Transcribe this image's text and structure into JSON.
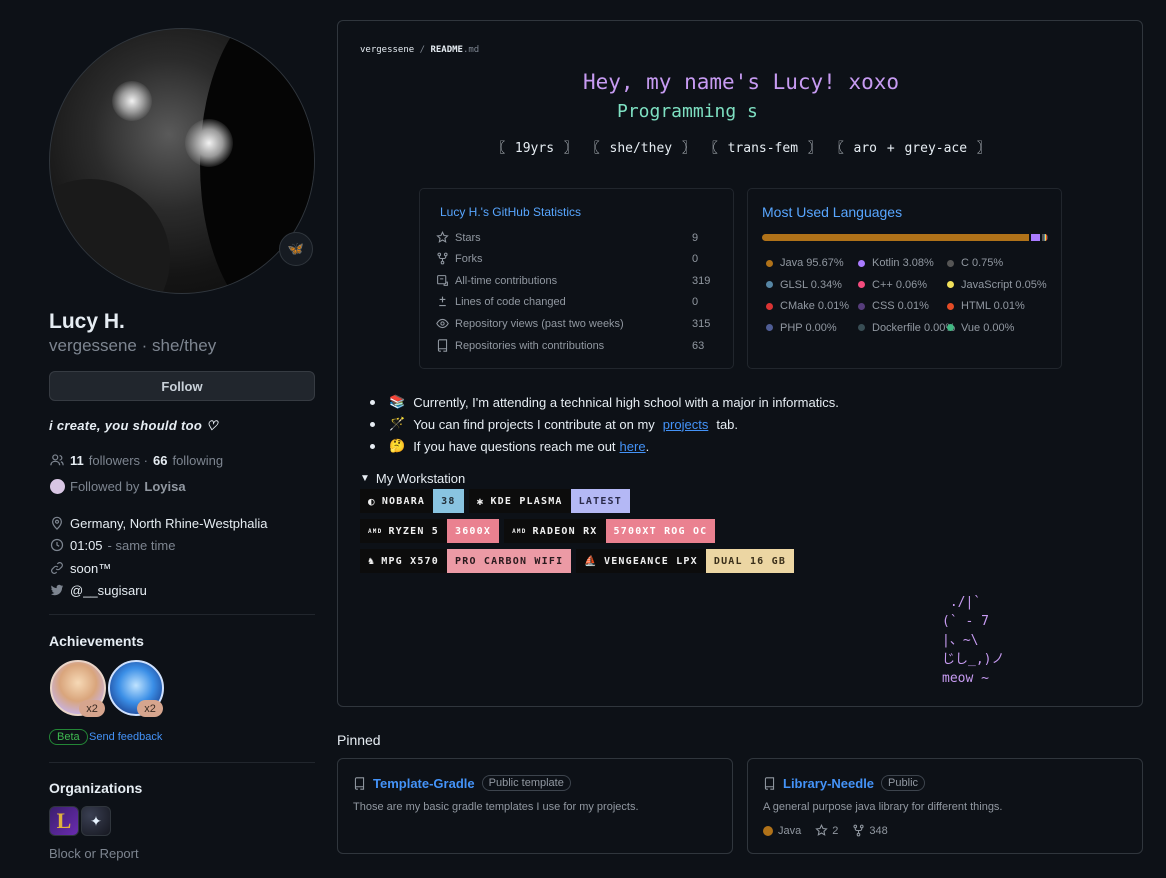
{
  "profile": {
    "name": "Lucy H.",
    "login_line": "vergessene · she/they",
    "follow_label": "Follow",
    "bio": "i create, you should too ♡",
    "followers_count": "11",
    "followers_label": "followers ·",
    "following_count": "66",
    "following_label": "following",
    "followed_by_prefix": "Followed by",
    "followed_by_name": "Loyisa",
    "location": "Germany, North Rhine-Westphalia",
    "time": "01:05",
    "time_note": "- same time",
    "website": "soon™",
    "twitter": "@__sugisaru",
    "status_emoji": "🦋"
  },
  "achievements": {
    "heading": "Achievements",
    "items": [
      {
        "count": "x2"
      },
      {
        "count": "x2"
      }
    ],
    "beta_label": "Beta",
    "feedback_label": "Send feedback"
  },
  "organizations": {
    "heading": "Organizations",
    "block_label": "Block or Report"
  },
  "readme": {
    "crumb_user": "vergessene",
    "crumb_sep": "/",
    "crumb_file": "README",
    "crumb_ext": ".md",
    "greeting": "Hey, my name's Lucy! xoxo",
    "typing": "Programming s",
    "tags": "〖 19yrs 〗 〖 she/they 〗 〖 trans-fem 〗 〖 aro + grey-ace 〗",
    "bullets": [
      {
        "emoji": "📚",
        "text": "Currently, I'm attending a technical high school with a major in informatics."
      },
      {
        "emoji": "🪄",
        "pre": "You can find projects I contribute at on my",
        "link": "projects",
        "post": "tab."
      },
      {
        "emoji": "🤔",
        "pre": "If you have questions reach me out",
        "link": "here",
        "post": "."
      }
    ],
    "workstation_label": "My Workstation",
    "badges": {
      "nobara": "NOBARA",
      "nobara_ver": "38",
      "kde": "KDE PLASMA",
      "kde_ver": "LATEST",
      "ryzen": "RYZEN 5",
      "ryzen_ver": "3600X",
      "radeon": "RADEON RX",
      "radeon_ver": "5700XT ROG OC",
      "mpg": "MPG X570",
      "mpg_ver": "PRO CARBON WIFI",
      "vengeance": "VENGEANCE LPX",
      "vengeance_ver": "DUAL 16 GB"
    },
    "ascii": " ./|`\n(` - 7\n|、~\\\nじし_,)ノ\nmeow ~"
  },
  "stats": {
    "title": "Lucy H.'s GitHub Statistics",
    "rows": [
      {
        "label": "Stars",
        "value": "9",
        "icon": "star-icon"
      },
      {
        "label": "Forks",
        "value": "0",
        "icon": "fork-icon"
      },
      {
        "label": "All-time contributions",
        "value": "319",
        "icon": "contributions-icon"
      },
      {
        "label": "Lines of code changed",
        "value": "0",
        "icon": "diff-icon"
      },
      {
        "label": "Repository views (past two weeks)",
        "value": "315",
        "icon": "eye-icon"
      },
      {
        "label": "Repositories with contributions",
        "value": "63",
        "icon": "repo-icon"
      }
    ]
  },
  "languages": {
    "title": "Most Used Languages",
    "items": [
      {
        "name": "Java",
        "pct": "95.67%",
        "value": 95.67,
        "color": "#b07219"
      },
      {
        "name": "Kotlin",
        "pct": "3.08%",
        "value": 3.08,
        "color": "#a97bff"
      },
      {
        "name": "C",
        "pct": "0.75%",
        "value": 0.75,
        "color": "#555555"
      },
      {
        "name": "GLSL",
        "pct": "0.34%",
        "value": 0.34,
        "color": "#5686a5"
      },
      {
        "name": "C++",
        "pct": "0.06%",
        "value": 0.06,
        "color": "#f34b7d"
      },
      {
        "name": "JavaScript",
        "pct": "0.05%",
        "value": 0.05,
        "color": "#f1e05a"
      },
      {
        "name": "CMake",
        "pct": "0.01%",
        "value": 0.01,
        "color": "#da3434"
      },
      {
        "name": "CSS",
        "pct": "0.01%",
        "value": 0.01,
        "color": "#563d7c"
      },
      {
        "name": "HTML",
        "pct": "0.01%",
        "value": 0.01,
        "color": "#e34c26"
      },
      {
        "name": "PHP",
        "pct": "0.00%",
        "value": 0.0,
        "color": "#4f5d95"
      },
      {
        "name": "Dockerfile",
        "pct": "0.00%",
        "value": 0.0,
        "color": "#384d54"
      },
      {
        "name": "Vue",
        "pct": "0.00%",
        "value": 0.0,
        "color": "#41b883"
      }
    ]
  },
  "pinned": {
    "heading": "Pinned",
    "repos": [
      {
        "name": "Template-Gradle",
        "visibility": "Public template",
        "description": "Those are my basic gradle templates I use for my projects."
      },
      {
        "name": "Library-Needle",
        "visibility": "Public",
        "description": "A general purpose java library for different things.",
        "language": "Java",
        "language_color": "#b07219",
        "stars": "2",
        "forks": "348"
      }
    ]
  }
}
